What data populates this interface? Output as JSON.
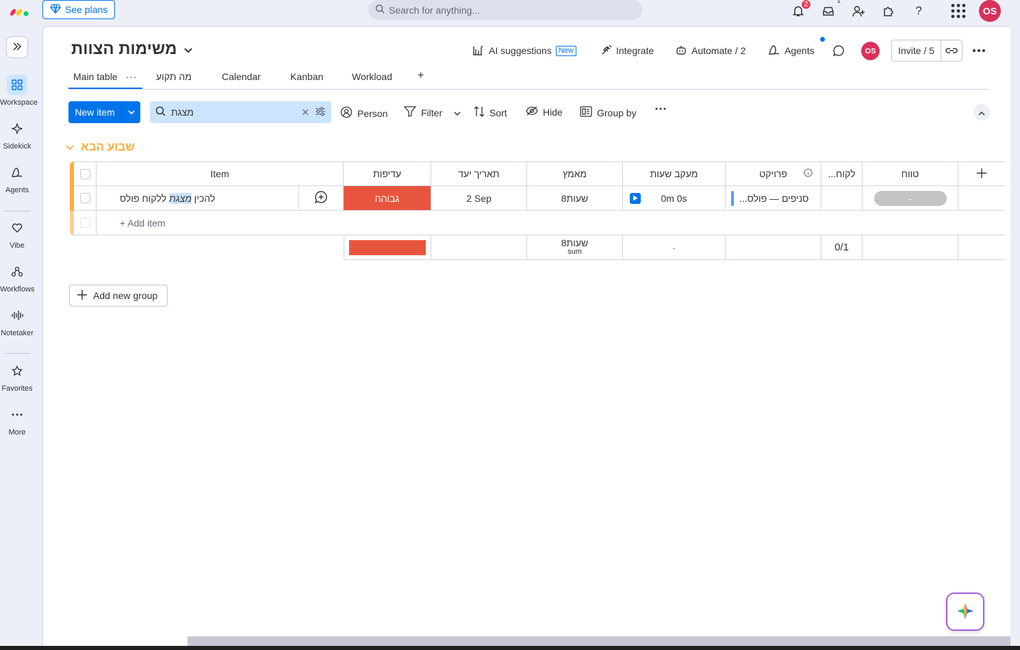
{
  "topbar": {
    "see_plans": "See plans",
    "search_placeholder": "Search for anything...",
    "notifications_count": "2",
    "inbox_count": "1",
    "avatar": "OS"
  },
  "rail": {
    "items": [
      {
        "label": "Workspace",
        "icon": "grid-icon"
      },
      {
        "label": "Sidekick",
        "icon": "sparkle-icon"
      },
      {
        "label": "Agents",
        "icon": "agents-icon"
      },
      {
        "label": "Vibe",
        "icon": "heart-icon"
      },
      {
        "label": "Workflows",
        "icon": "workflows-icon"
      },
      {
        "label": "Notetaker",
        "icon": "waveform-icon"
      },
      {
        "label": "Favorites",
        "icon": "star-icon"
      },
      {
        "label": "More",
        "icon": "more-icon"
      }
    ]
  },
  "board": {
    "title": "משימות הצוות",
    "actions": {
      "ai_suggestions": "AI suggestions",
      "new_tag": "New",
      "integrate": "Integrate",
      "automate": "Automate / 2",
      "agents": "Agents",
      "avatar": "OS",
      "invite": "Invite / 5"
    },
    "tabs": [
      "Main table",
      "מה תקוע",
      "Calendar",
      "Kanban",
      "Workload",
      "+"
    ]
  },
  "toolbar": {
    "new_item": "New item",
    "search_value": "מצגת",
    "person": "Person",
    "filter": "Filter",
    "sort": "Sort",
    "hide": "Hide",
    "group_by": "Group by"
  },
  "group": {
    "title": "שבוע הבא",
    "color": "#fdab3d",
    "columns": {
      "item": "Item",
      "priority": "עדיפות",
      "due_date": "תאריך יעד",
      "effort": "מאמץ",
      "time_tracking": "מעקב שעות",
      "project": "פרויקט",
      "client": "...לקוח",
      "range": "טווח"
    },
    "rows": [
      {
        "item_pre": "להכין ",
        "item_highlight": "מצגת",
        "item_post": " ללקוח פולס",
        "priority": "גבוהה",
        "due_date": "2 Sep",
        "effort": "8שעות",
        "time_tracking": "0m 0s",
        "project": "...סניפים — פולס",
        "client": "",
        "range": "-"
      }
    ],
    "add_item": "+ Add item",
    "summary": {
      "effort": "8שעות",
      "effort_label": "sum",
      "time_tracking": "-",
      "client": "0/1"
    }
  },
  "add_group": "Add new group",
  "colors": {
    "primary": "#0073ea",
    "priority_high": "#e8553e",
    "group": "#fdab3d",
    "avatar": "#d8315b"
  }
}
